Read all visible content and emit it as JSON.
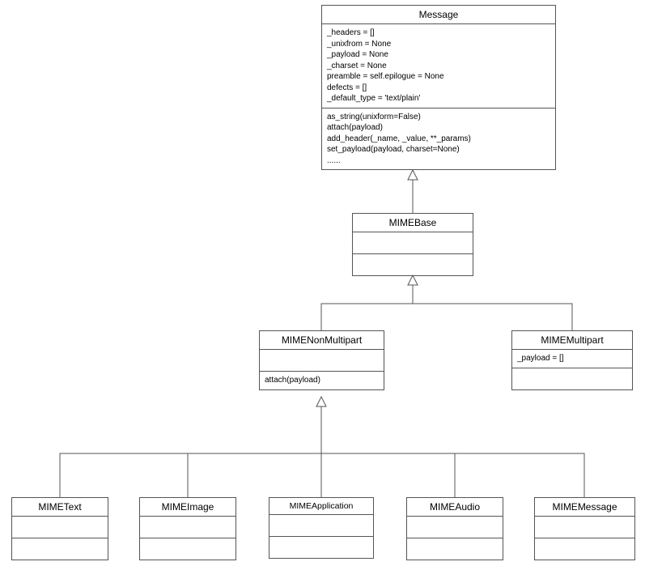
{
  "classes": {
    "message": {
      "name": "Message",
      "attributes": "_headers = []\n_unixfrom = None\n_payload = None\n_charset = None\npreamble = self.epilogue = None\ndefects = []\n_default_type = 'text/plain'",
      "methods": "as_string(unixform=False)\nattach(payload)\nadd_header(_name, _value, **_params)\nset_payload(payload, charset=None)\n......"
    },
    "mimebase": {
      "name": "MIMEBase",
      "attributes": "",
      "methods": ""
    },
    "mimenonmultipart": {
      "name": "MIMENonMultipart",
      "attributes": "",
      "methods": "attach(payload)"
    },
    "mimemultipart": {
      "name": "MIMEMultipart",
      "attributes": "_payload = []",
      "methods": ""
    },
    "mimetext": {
      "name": "MIMEText",
      "attributes": "",
      "methods": ""
    },
    "mimeimage": {
      "name": "MIMEImage",
      "attributes": "",
      "methods": ""
    },
    "mimeapplication": {
      "name": "MIMEApplication",
      "attributes": "",
      "methods": ""
    },
    "mimeaudio": {
      "name": "MIMEAudio",
      "attributes": "",
      "methods": ""
    },
    "mimemessage": {
      "name": "MIMEMessage",
      "attributes": "",
      "methods": ""
    }
  },
  "relationships": [
    {
      "from": "mimebase",
      "to": "message",
      "type": "inheritance"
    },
    {
      "from": "mimenonmultipart",
      "to": "mimebase",
      "type": "inheritance"
    },
    {
      "from": "mimemultipart",
      "to": "mimebase",
      "type": "inheritance"
    },
    {
      "from": "mimetext",
      "to": "mimenonmultipart",
      "type": "inheritance"
    },
    {
      "from": "mimeimage",
      "to": "mimenonmultipart",
      "type": "inheritance"
    },
    {
      "from": "mimeapplication",
      "to": "mimenonmultipart",
      "type": "inheritance"
    },
    {
      "from": "mimeaudio",
      "to": "mimenonmultipart",
      "type": "inheritance"
    },
    {
      "from": "mimemessage",
      "to": "mimenonmultipart",
      "type": "inheritance"
    }
  ]
}
